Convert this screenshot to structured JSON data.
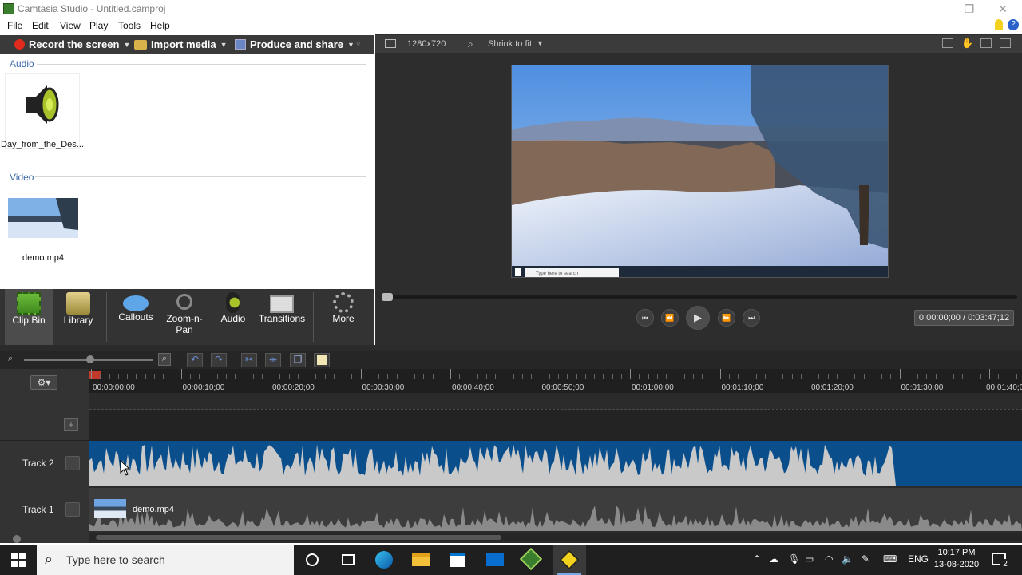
{
  "window": {
    "title": "Camtasia Studio - Untitled.camproj"
  },
  "menu": [
    "File",
    "Edit",
    "View",
    "Play",
    "Tools",
    "Help"
  ],
  "actions": {
    "record": "Record the screen",
    "import": "Import media",
    "produce": "Produce and share"
  },
  "clipbin": {
    "audio_header": "Audio",
    "audio_clip": "Day_from_the_Des...",
    "video_header": "Video",
    "video_clip": "demo.mp4"
  },
  "tasks": {
    "clipbin": "Clip Bin",
    "library": "Library",
    "callouts": "Callouts",
    "zoom": "Zoom-n-\nPan",
    "audio": "Audio",
    "transitions": "Transitions",
    "more": "More"
  },
  "preview": {
    "dimensions": "1280x720",
    "zoom": "Shrink to fit",
    "timecode": "0:00:00;00 / 0:03:47;12",
    "playback_progress": 0.0
  },
  "timeline": {
    "ruler": [
      "00:00:00;00",
      "00:00:10;00",
      "00:00:20;00",
      "00:00:30;00",
      "00:00:40;00",
      "00:00:50;00",
      "00:01:00;00",
      "00:01:10;00",
      "00:01:20;00",
      "00:01:30;00",
      "00:01:40;00"
    ],
    "track2": "Track 2",
    "track1": "Track 1",
    "track1_clip": "demo.mp4"
  },
  "taskbar": {
    "search_placeholder": "Type here to search",
    "lang": "ENG",
    "time": "10:17 PM",
    "date": "13-08-2020",
    "notifications": "2"
  },
  "colors": {
    "accent": "#3b6aa8",
    "track_audio": "#0a4f8c"
  }
}
